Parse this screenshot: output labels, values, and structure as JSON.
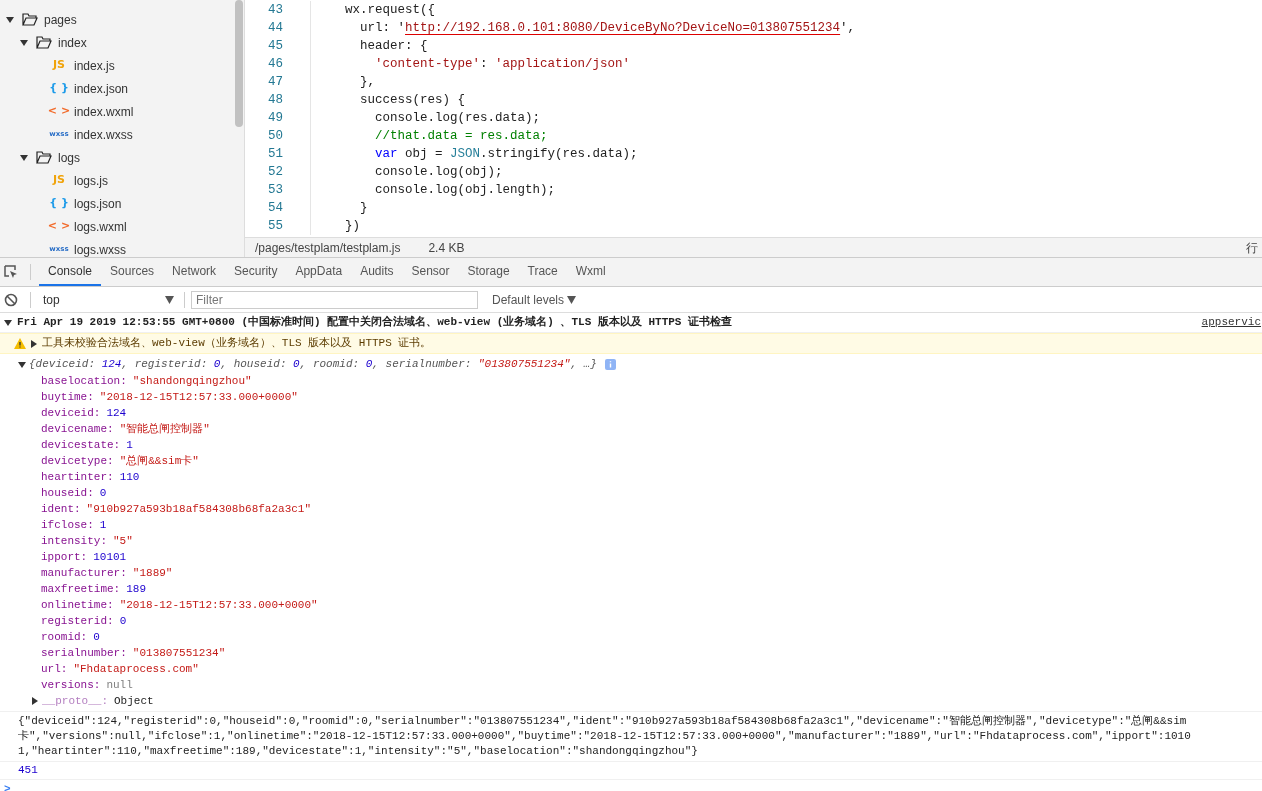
{
  "file_tree": [
    {
      "name": "pages",
      "expanded": true,
      "children": [
        {
          "name": "index",
          "expanded": true,
          "children": [
            {
              "name": "index.js",
              "kind": "js",
              "badge": "JS"
            },
            {
              "name": "index.json",
              "kind": "json",
              "badge": "{ }"
            },
            {
              "name": "index.wxml",
              "kind": "wxml",
              "badge": "< >"
            },
            {
              "name": "index.wxss",
              "kind": "wxss",
              "badge": "wxss"
            }
          ]
        },
        {
          "name": "logs",
          "expanded": true,
          "children": [
            {
              "name": "logs.js",
              "kind": "js",
              "badge": "JS"
            },
            {
              "name": "logs.json",
              "kind": "json",
              "badge": "{ }"
            },
            {
              "name": "logs.wxml",
              "kind": "wxml",
              "badge": "< >"
            },
            {
              "name": "logs.wxss",
              "kind": "wxss",
              "badge": "wxss"
            }
          ]
        }
      ]
    }
  ],
  "editor": {
    "lines": [
      {
        "number": "43",
        "tokens": [
          {
            "text": "    wx.request({",
            "kind": "plain"
          }
        ]
      },
      {
        "number": "44",
        "tokens": [
          {
            "text": "      url: '",
            "kind": "plain"
          },
          {
            "text": "http://192.168.0.101:8080/DeviceByNo?DeviceNo=013807551234",
            "kind": "url"
          },
          {
            "text": "',",
            "kind": "plain"
          }
        ]
      },
      {
        "number": "45",
        "tokens": [
          {
            "text": "      header: {",
            "kind": "plain"
          }
        ]
      },
      {
        "number": "46",
        "tokens": [
          {
            "text": "        'content-type'",
            "kind": "string"
          },
          {
            "text": ": ",
            "kind": "plain"
          },
          {
            "text": "'application/json'",
            "kind": "string"
          }
        ]
      },
      {
        "number": "47",
        "tokens": [
          {
            "text": "      },",
            "kind": "plain"
          }
        ]
      },
      {
        "number": "48",
        "tokens": [
          {
            "text": "      success(res) {",
            "kind": "plain"
          }
        ]
      },
      {
        "number": "49",
        "tokens": [
          {
            "text": "        console.log(res.data);",
            "kind": "plain"
          }
        ]
      },
      {
        "number": "50",
        "tokens": [
          {
            "text": "        //that.data = res.data;",
            "kind": "comment"
          }
        ]
      },
      {
        "number": "51",
        "tokens": [
          {
            "text": "        var",
            "kind": "keyword"
          },
          {
            "text": " obj = ",
            "kind": "plain"
          },
          {
            "text": "JSON",
            "kind": "builtin"
          },
          {
            "text": ".stringify(res.data);",
            "kind": "plain"
          }
        ]
      },
      {
        "number": "52",
        "tokens": [
          {
            "text": "        console.log(obj);",
            "kind": "plain"
          }
        ]
      },
      {
        "number": "53",
        "tokens": [
          {
            "text": "        console.log(obj.length);",
            "kind": "plain"
          }
        ]
      },
      {
        "number": "54",
        "tokens": [
          {
            "text": "      }",
            "kind": "plain"
          }
        ]
      },
      {
        "number": "55",
        "tokens": [
          {
            "text": "    })",
            "kind": "plain"
          }
        ]
      }
    ]
  },
  "status_bar": {
    "path": "/pages/testplam/testplam.js",
    "size": "2.4 KB",
    "position": "行"
  },
  "devtools_tabs": [
    {
      "label": "Console",
      "selected": true
    },
    {
      "label": "Sources",
      "selected": false
    },
    {
      "label": "Network",
      "selected": false
    },
    {
      "label": "Security",
      "selected": false
    },
    {
      "label": "AppData",
      "selected": false
    },
    {
      "label": "Audits",
      "selected": false
    },
    {
      "label": "Sensor",
      "selected": false
    },
    {
      "label": "Storage",
      "selected": false
    },
    {
      "label": "Trace",
      "selected": false
    },
    {
      "label": "Wxml",
      "selected": false
    }
  ],
  "console_toolbar": {
    "context": "top",
    "filter_placeholder": "Filter",
    "levels": "Default levels"
  },
  "console_messages": [
    {
      "kind": "group",
      "expanded": true,
      "text": "Fri Apr 19 2019 12:53:55 GMT+0800 (中国标准时间) 配置中关闭合法域名、web-view (业务域名) 、TLS 版本以及 HTTPS 证书检查",
      "source": "appservic"
    },
    {
      "kind": "warning",
      "text": "工具未校验合法域名、web-view（业务域名）、TLS 版本以及 HTTPS 证书。"
    },
    {
      "kind": "object",
      "expanded": true,
      "summary": [
        {
          "text": "{deviceid: ",
          "kind": "key"
        },
        {
          "text": "124",
          "kind": "number"
        },
        {
          "text": ", registerid: ",
          "kind": "key"
        },
        {
          "text": "0",
          "kind": "number"
        },
        {
          "text": ", houseid: ",
          "kind": "key"
        },
        {
          "text": "0",
          "kind": "number"
        },
        {
          "text": ", roomid: ",
          "kind": "key"
        },
        {
          "text": "0",
          "kind": "number"
        },
        {
          "text": ", serialnumber: ",
          "kind": "key"
        },
        {
          "text": "\"013807551234\"",
          "kind": "string"
        },
        {
          "text": ", …}",
          "kind": "key"
        }
      ],
      "properties": [
        {
          "key": "baselocation:",
          "value": "\"shandongqingzhou\"",
          "kind": "string"
        },
        {
          "key": "buytime:",
          "value": "\"2018-12-15T12:57:33.000+0000\"",
          "kind": "string"
        },
        {
          "key": "deviceid:",
          "value": "124",
          "kind": "number"
        },
        {
          "key": "devicename:",
          "value": "\"智能总闸控制器\"",
          "kind": "string"
        },
        {
          "key": "devicestate:",
          "value": "1",
          "kind": "number"
        },
        {
          "key": "devicetype:",
          "value": "\"总闸&&sim卡\"",
          "kind": "string"
        },
        {
          "key": "heartinter:",
          "value": "110",
          "kind": "number"
        },
        {
          "key": "houseid:",
          "value": "0",
          "kind": "number"
        },
        {
          "key": "ident:",
          "value": "\"910b927a593b18af584308b68fa2a3c1\"",
          "kind": "string"
        },
        {
          "key": "ifclose:",
          "value": "1",
          "kind": "number"
        },
        {
          "key": "intensity:",
          "value": "\"5\"",
          "kind": "string"
        },
        {
          "key": "ipport:",
          "value": "10101",
          "kind": "number"
        },
        {
          "key": "manufacturer:",
          "value": "\"1889\"",
          "kind": "string"
        },
        {
          "key": "maxfreetime:",
          "value": "189",
          "kind": "number"
        },
        {
          "key": "onlinetime:",
          "value": "\"2018-12-15T12:57:33.000+0000\"",
          "kind": "string"
        },
        {
          "key": "registerid:",
          "value": "0",
          "kind": "number"
        },
        {
          "key": "roomid:",
          "value": "0",
          "kind": "number"
        },
        {
          "key": "serialnumber:",
          "value": "\"013807551234\"",
          "kind": "string"
        },
        {
          "key": "url:",
          "value": "\"Fhdataprocess.com\"",
          "kind": "string"
        },
        {
          "key": "versions:",
          "value": "null",
          "kind": "null"
        }
      ],
      "proto": {
        "key": "__proto__:",
        "value": "Object",
        "expanded": false
      }
    },
    {
      "kind": "text",
      "text": "{\"deviceid\":124,\"registerid\":0,\"houseid\":0,\"roomid\":0,\"serialnumber\":\"013807551234\",\"ident\":\"910b927a593b18af584308b68fa2a3c1\",\"devicename\":\"智能总闸控制器\",\"devicetype\":\"总闸&&sim卡\",\"versions\":null,\"ifclose\":1,\"onlinetime\":\"2018-12-15T12:57:33.000+0000\",\"buytime\":\"2018-12-15T12:57:33.000+0000\",\"manufacturer\":\"1889\",\"url\":\"Fhdataprocess.com\",\"ipport\":10101,\"heartinter\":110,\"maxfreetime\":189,\"devicestate\":1,\"intensity\":\"5\",\"baselocation\":\"shandongqingzhou\"}"
    },
    {
      "kind": "number",
      "text": "451"
    }
  ],
  "prompt": ">"
}
